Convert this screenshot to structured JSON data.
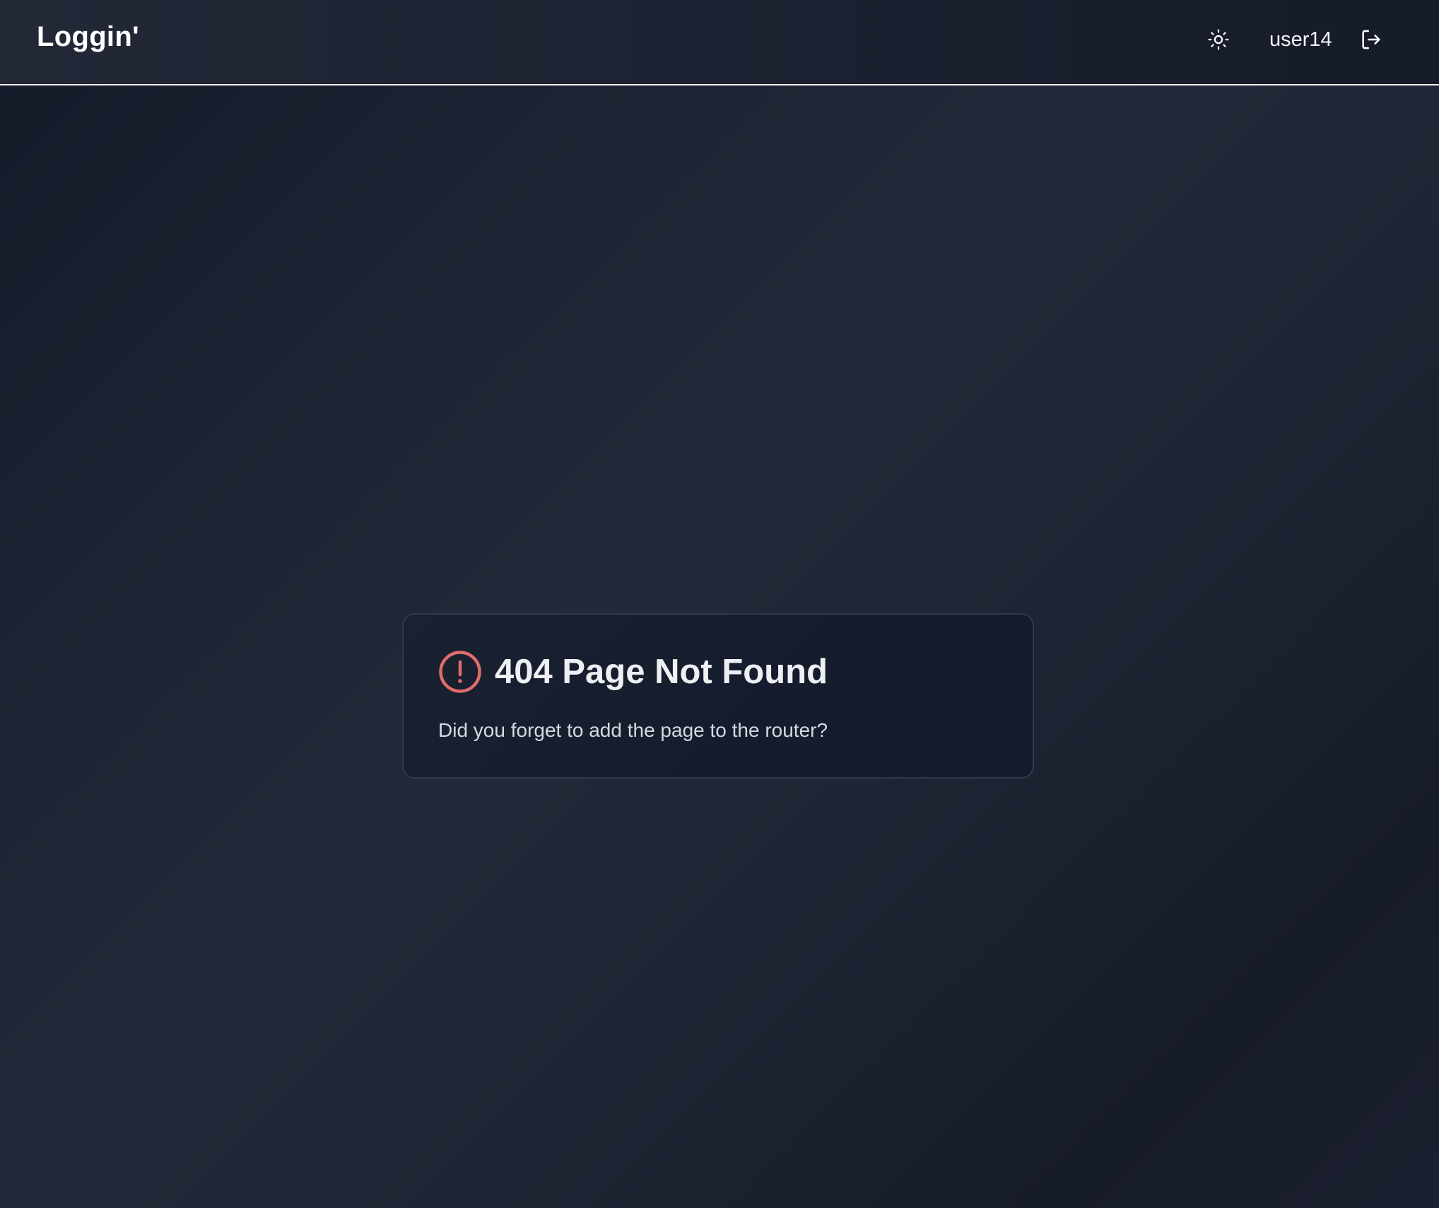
{
  "header": {
    "brand": "Loggin'",
    "theme_toggle_icon": "sun-icon",
    "username": "user14",
    "logout_icon": "logout-icon"
  },
  "error_card": {
    "icon": "alert-circle-icon",
    "icon_color": "#e06c6c",
    "title": "404 Page Not Found",
    "message": "Did you forget to add the page to the router?"
  }
}
